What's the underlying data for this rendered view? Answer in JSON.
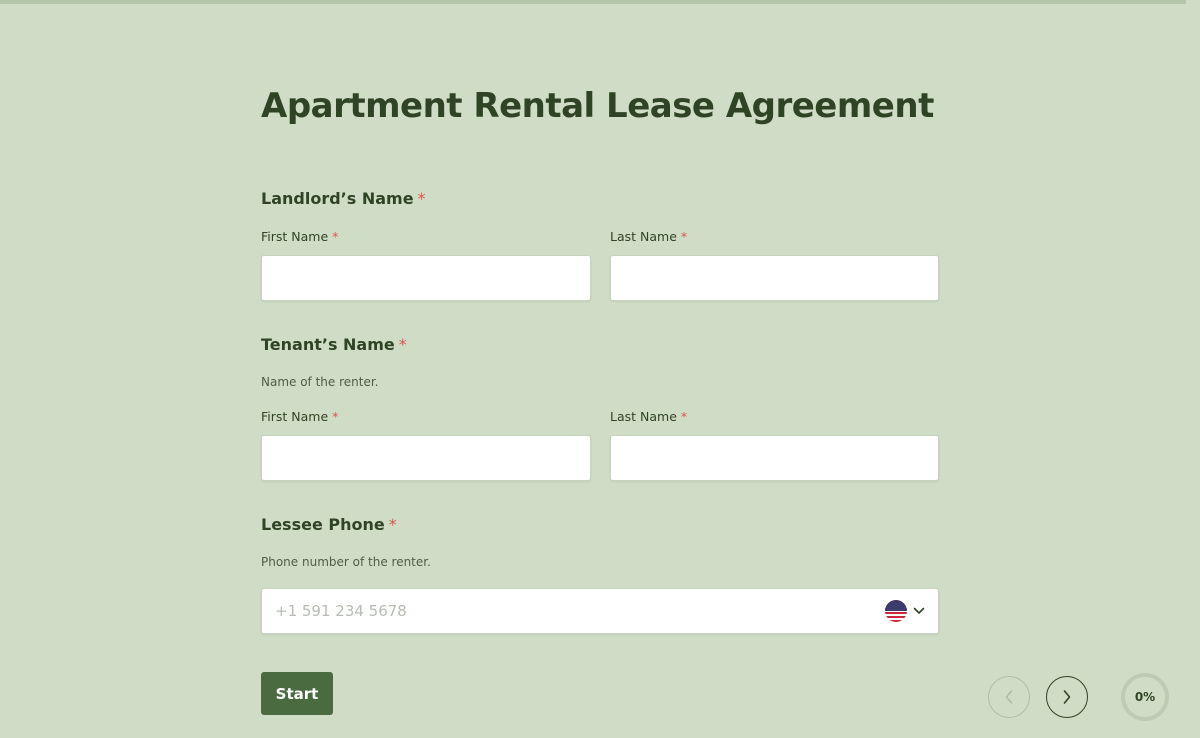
{
  "form": {
    "title": "Apartment Rental Lease Agreement",
    "required_mark": "*",
    "landlord": {
      "label": "Landlord’s Name",
      "first_label": "First Name",
      "last_label": "Last Name",
      "first_value": "",
      "last_value": ""
    },
    "tenant": {
      "label": "Tenant’s Name",
      "help": "Name of the renter.",
      "first_label": "First Name",
      "last_label": "Last Name",
      "first_value": "",
      "last_value": ""
    },
    "phone": {
      "label": "Lessee Phone",
      "help": "Phone number of the renter.",
      "placeholder": "+1 591 234 5678",
      "value": "",
      "country_flag_icon": "us-flag-icon"
    },
    "start_label": "Start"
  },
  "footer": {
    "progress_text": "0%",
    "progress": 0
  },
  "colors": {
    "background": "#d0ddc6",
    "accent": "#4a6b40",
    "heading": "#2e4425",
    "required": "#e05252"
  }
}
